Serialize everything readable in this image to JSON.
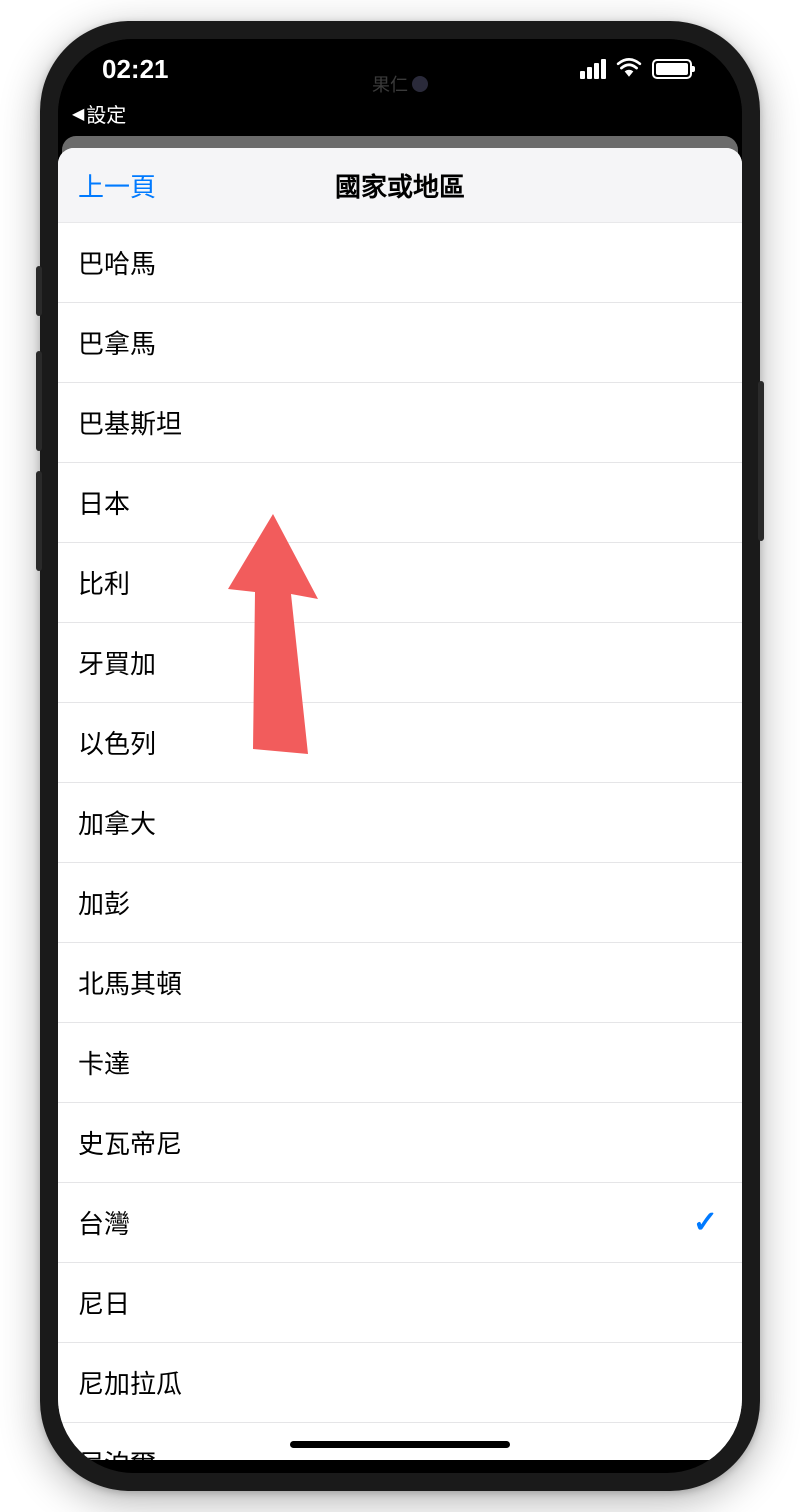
{
  "status_bar": {
    "time": "02:21"
  },
  "dynamic_island": {
    "text": "果仁"
  },
  "breadcrumb": {
    "label": "設定"
  },
  "nav": {
    "back_label": "上一頁",
    "title": "國家或地區"
  },
  "countries": [
    {
      "name": "巴哈馬",
      "selected": false
    },
    {
      "name": "巴拿馬",
      "selected": false
    },
    {
      "name": "巴基斯坦",
      "selected": false
    },
    {
      "name": "日本",
      "selected": false
    },
    {
      "name": "比利",
      "selected": false
    },
    {
      "name": "牙買加",
      "selected": false
    },
    {
      "name": "以色列",
      "selected": false
    },
    {
      "name": "加拿大",
      "selected": false
    },
    {
      "name": "加彭",
      "selected": false
    },
    {
      "name": "北馬其頓",
      "selected": false
    },
    {
      "name": "卡達",
      "selected": false
    },
    {
      "name": "史瓦帝尼",
      "selected": false
    },
    {
      "name": "台灣",
      "selected": true
    },
    {
      "name": "尼日",
      "selected": false
    },
    {
      "name": "尼加拉瓜",
      "selected": false
    },
    {
      "name": "尼泊爾",
      "selected": false
    }
  ],
  "colors": {
    "accent": "#007aff",
    "arrow": "#f25c5c"
  }
}
